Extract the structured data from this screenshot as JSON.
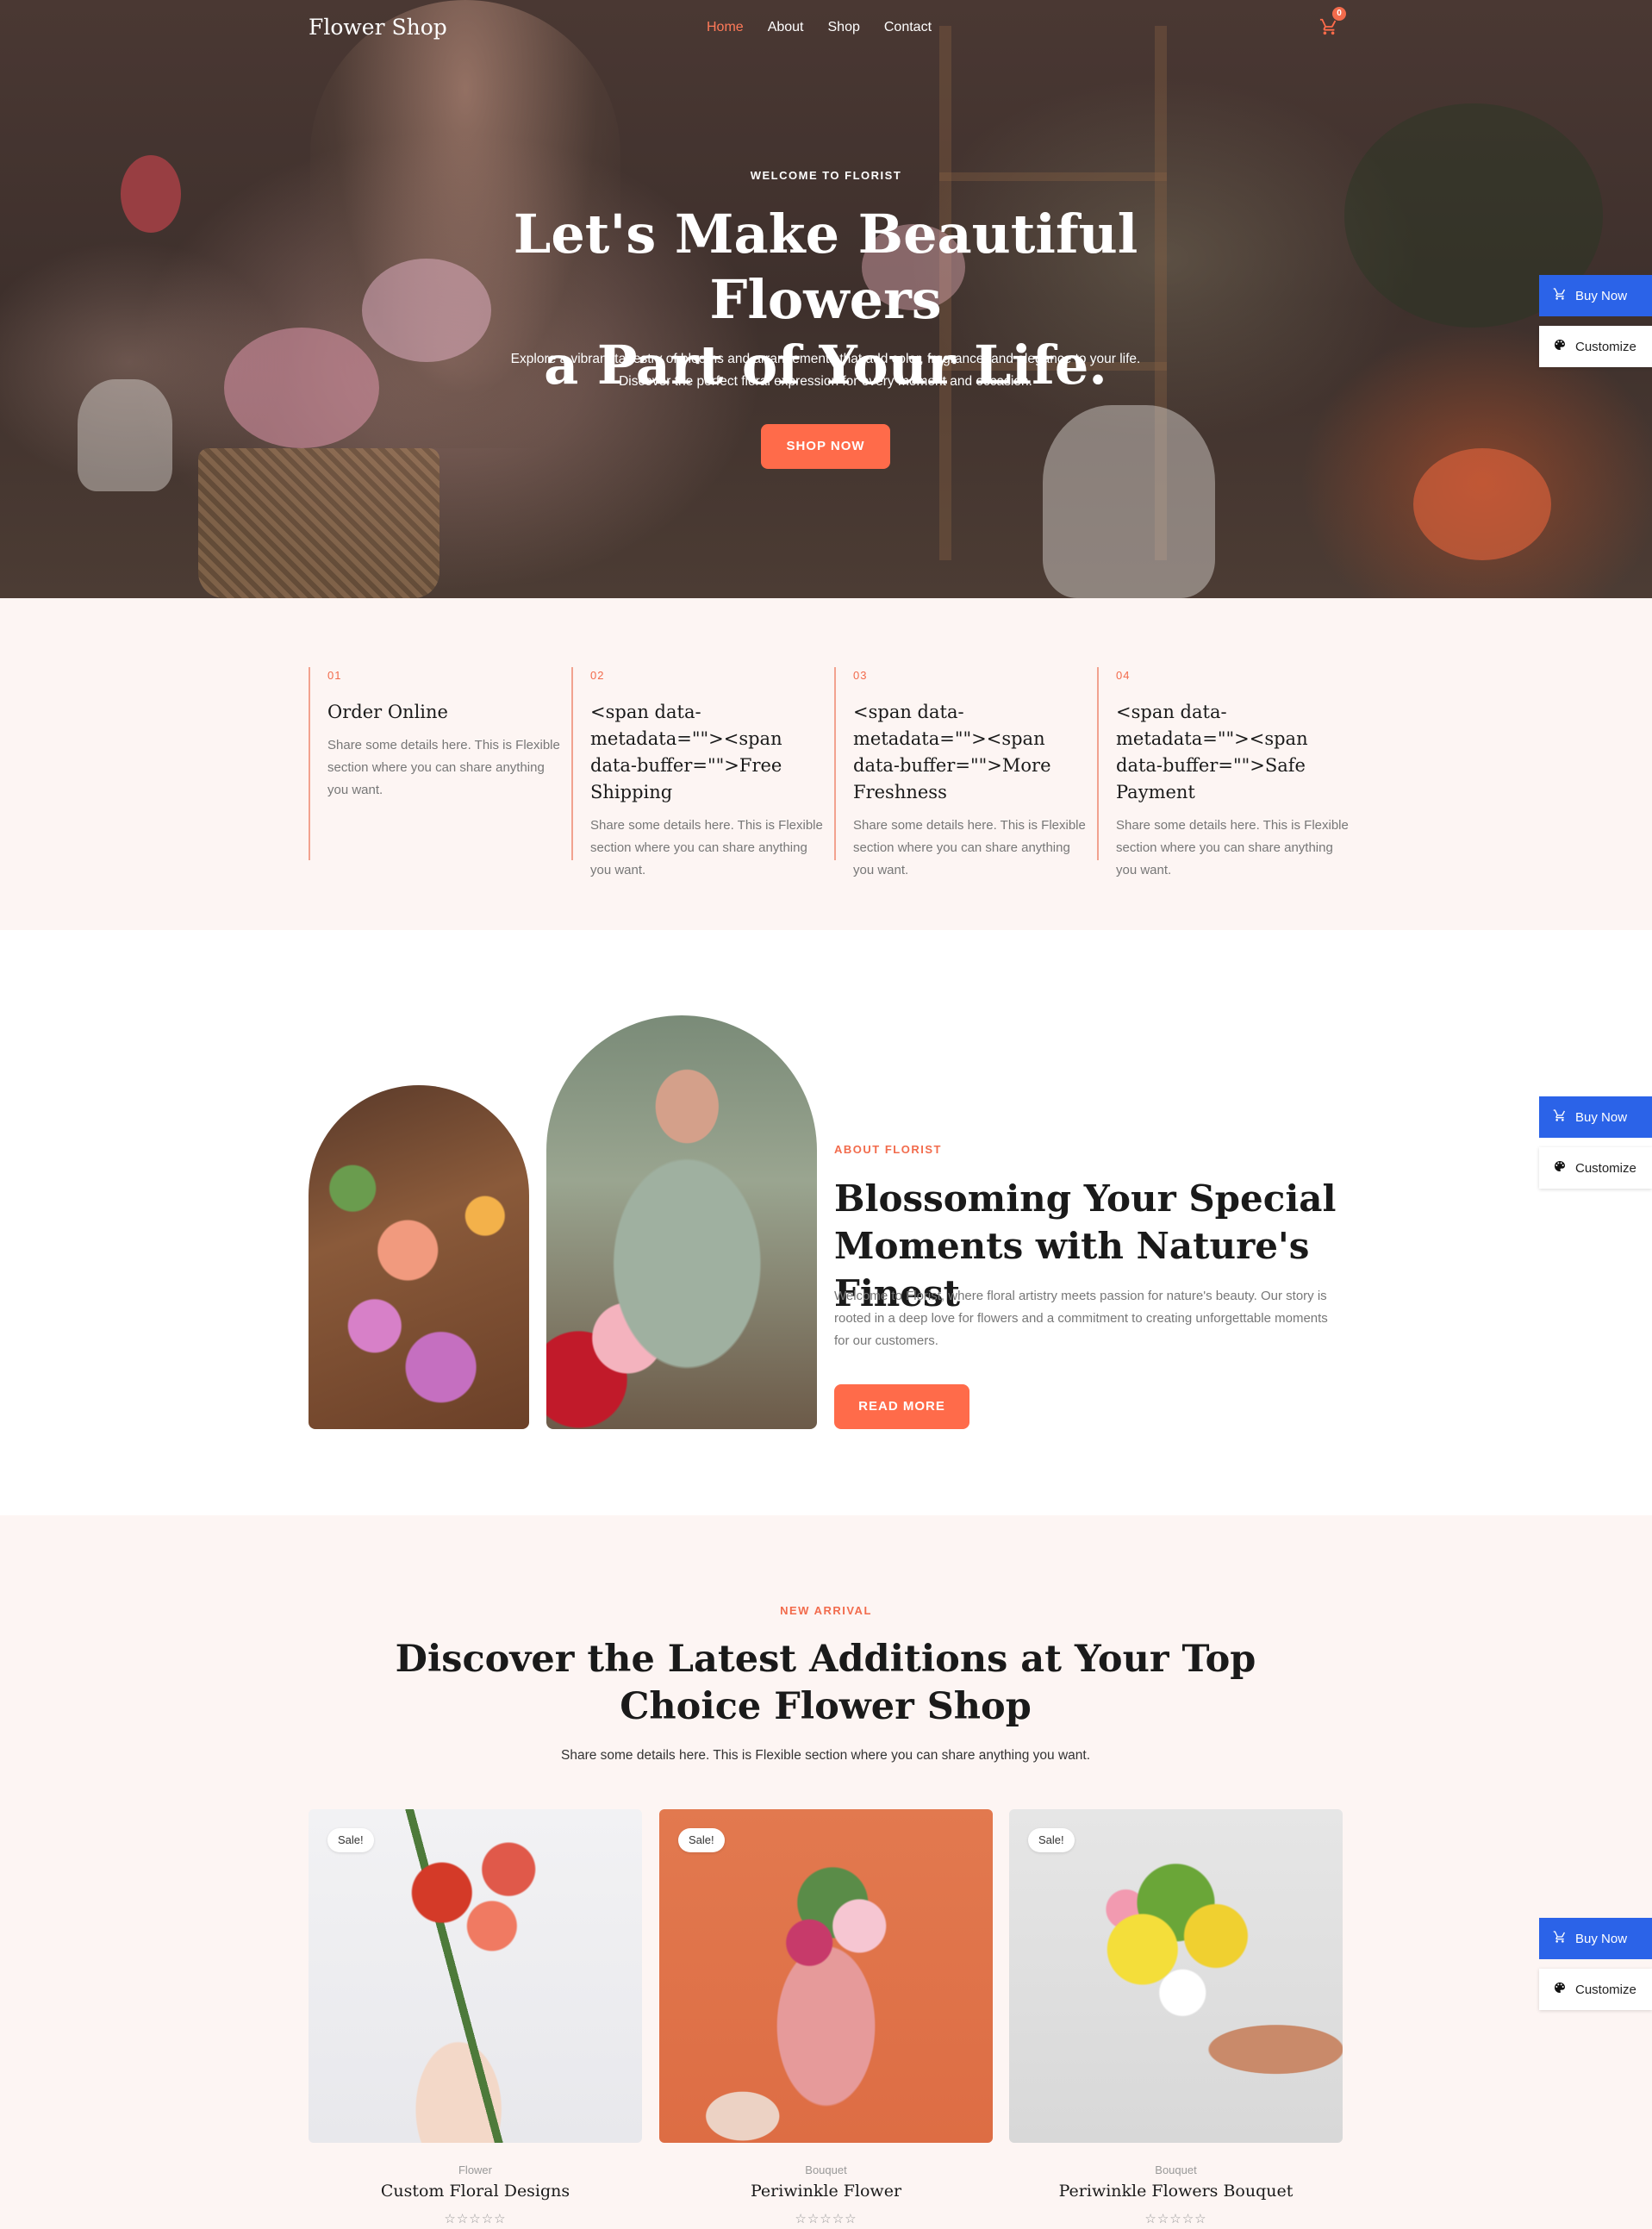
{
  "header": {
    "logo": "Flower Shop",
    "nav": [
      "Home",
      "About",
      "Shop",
      "Contact"
    ],
    "cart_count": "0"
  },
  "hero": {
    "eyebrow": "WELCOME TO FLORIST",
    "title_line1": "Let's Make Beautiful Flowers",
    "title_line2": "a Part of Your Life.",
    "subtitle_line1": "Explore a vibrant tapestry of blooms and arrangements that add color, fragrance, and elegance to your life.",
    "subtitle_line2": "Discover the perfect floral expression for every moment and occasion.",
    "button": "SHOP NOW"
  },
  "side_widget": {
    "buy_label": "Buy Now",
    "customize_label": "Customize",
    "buy_color": "#2b63e8"
  },
  "features": [
    {
      "num": "01",
      "title": "Order Online",
      "desc": "Share some details here. This is Flexible section where you can share anything you want."
    },
    {
      "num": "02",
      "title": "<span data-metadata=\"\"><span data-buffer=\"\">Free Shipping",
      "desc": "Share some details here. This is Flexible section where you can share anything you want."
    },
    {
      "num": "03",
      "title": "<span data-metadata=\"\"><span data-buffer=\"\">More Freshness",
      "desc": "Share some details here. This is Flexible section where you can share anything you want."
    },
    {
      "num": "04",
      "title": "<span data-metadata=\"\"><span data-buffer=\"\">Safe Payment",
      "desc": "Share some details here. This is Flexible section where you can share anything you want."
    }
  ],
  "about": {
    "eyebrow": "ABOUT FLORIST",
    "title_line1": "Blossoming Your Special",
    "title_line2": "Moments with Nature's Finest",
    "desc": "Welcome to Florist, where floral artistry meets passion for nature's beauty. Our story is rooted in a deep love for flowers and a commitment to creating unforgettable moments for our customers.",
    "button": "READ MORE"
  },
  "arrivals": {
    "eyebrow": "NEW ARRIVAL",
    "title_line1": "Discover the Latest Additions at Your Top",
    "title_line2": "Choice Flower Shop",
    "subtitle": "Share some details here. This is Flexible section where you can share anything you want.",
    "products": [
      {
        "badge": "Sale!",
        "category": "Flower",
        "name": "Custom Floral Designs",
        "stars": "☆☆☆☆☆"
      },
      {
        "badge": "Sale!",
        "category": "Bouquet",
        "name": "Periwinkle Flower",
        "stars": "☆☆☆☆☆"
      },
      {
        "badge": "Sale!",
        "category": "Bouquet",
        "name": "Periwinkle Flowers Bouquet",
        "stars": "☆☆☆☆☆"
      }
    ]
  },
  "colors": {
    "accent": "#ff6b4a",
    "section_bg": "#fdf5f3"
  }
}
